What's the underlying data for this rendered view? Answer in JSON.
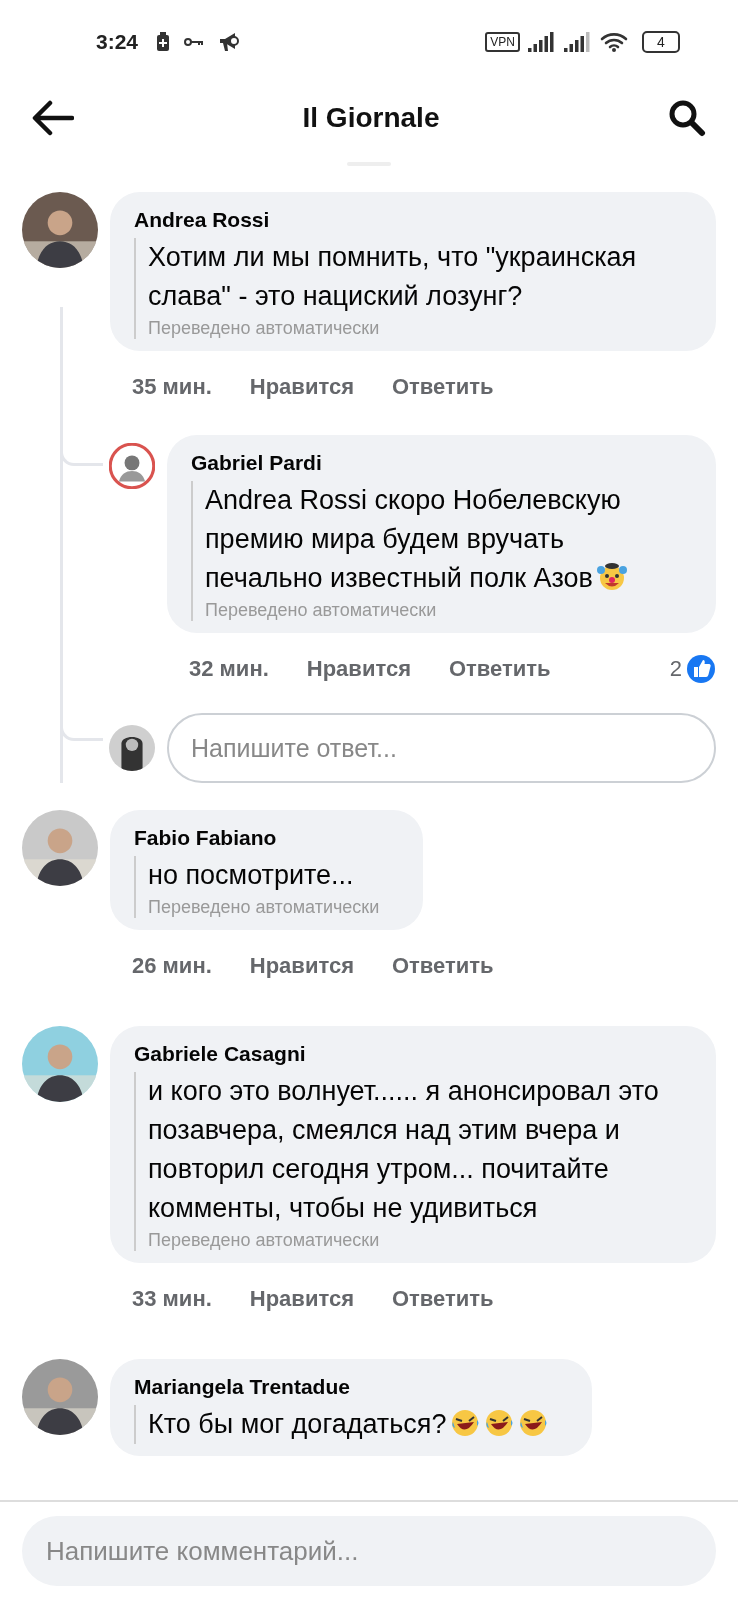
{
  "status_bar": {
    "time": "3:24",
    "vpn": "VPN",
    "battery": "4"
  },
  "header": {
    "title": "Il Giornale"
  },
  "comments": [
    {
      "author": "Andrea Rossi",
      "text": "Хотим ли мы помнить, что \"украинская слава\" - это нациский лозунг?",
      "translated": "Переведено автоматически",
      "time": "35 мин.",
      "like": "Нравится",
      "reply": "Ответить",
      "replies": [
        {
          "author": "Gabriel Pardi",
          "text": "Andrea Rossi скоро Нобелевскую премию мира будем вручать печально известный полк Азов",
          "emojis": [
            {
              "kind": "clown"
            }
          ],
          "translated": "Переведено автоматически",
          "time": "32 мин.",
          "like": "Нравится",
          "reply": "Ответить",
          "reaction_count": "2"
        }
      ],
      "reply_field": {
        "placeholder": "Напишите ответ..."
      }
    },
    {
      "author": "Fabio Fabiano",
      "text": "но посмотрите...",
      "translated": "Переведено автоматически",
      "time": "26 мин.",
      "like": "Нравится",
      "reply": "Ответить"
    },
    {
      "author": "Gabriele Casagni",
      "text": "и кого это волнует...... я анонсировал это позавчера, смеялся над этим вчера и повторил сегодня утром... почитайте комменты, чтобы не удивиться",
      "translated": "Переведено автоматически",
      "time": "33 мин.",
      "like": "Нравится",
      "reply": "Ответить"
    },
    {
      "author": "Mariangela Trentadue",
      "text": "Кто бы мог догадаться?",
      "emojis": [
        {
          "kind": "rofl"
        },
        {
          "kind": "rofl"
        },
        {
          "kind": "rofl"
        }
      ]
    }
  ],
  "composer": {
    "placeholder": "Напишите комментарий..."
  }
}
